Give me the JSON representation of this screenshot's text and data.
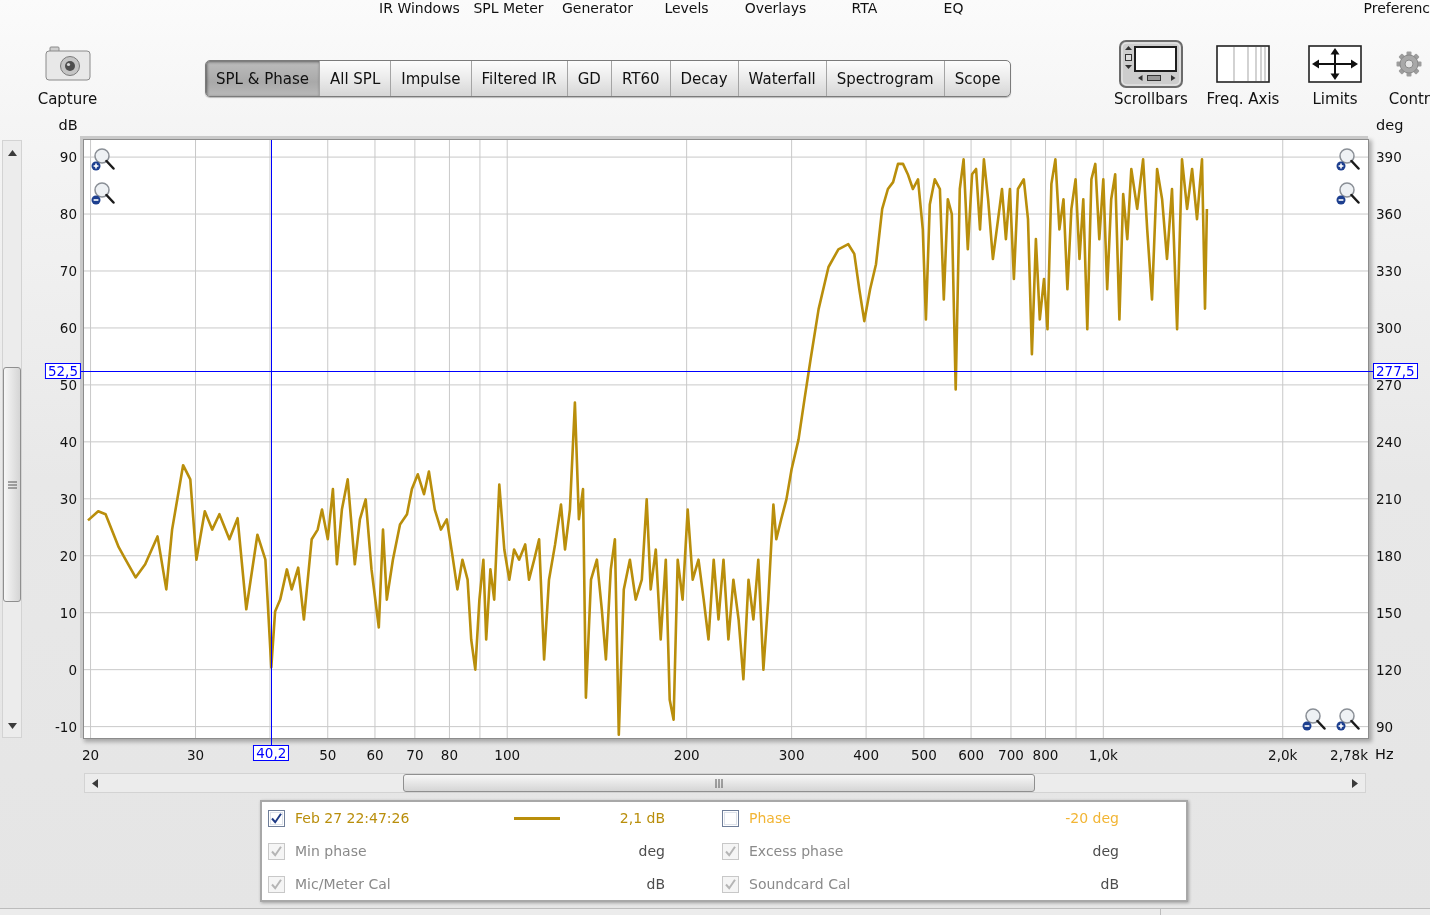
{
  "menu": [
    "IR Windows",
    "SPL Meter",
    "Generator",
    "Levels",
    "Overlays",
    "RTA",
    "EQ"
  ],
  "menu_right": [
    "Preferenc"
  ],
  "capture": {
    "label": "Capture"
  },
  "tabs": [
    {
      "label": "SPL & Phase",
      "selected": true
    },
    {
      "label": "All SPL",
      "selected": false
    },
    {
      "label": "Impulse",
      "selected": false
    },
    {
      "label": "Filtered IR",
      "selected": false
    },
    {
      "label": "GD",
      "selected": false
    },
    {
      "label": "RT60",
      "selected": false
    },
    {
      "label": "Decay",
      "selected": false
    },
    {
      "label": "Waterfall",
      "selected": false
    },
    {
      "label": "Spectrogram",
      "selected": false
    },
    {
      "label": "Scope",
      "selected": false
    }
  ],
  "tools": [
    {
      "label": "Scrollbars",
      "kind": "scrollbars",
      "on": true
    },
    {
      "label": "Freq. Axis",
      "kind": "grid",
      "on": false
    },
    {
      "label": "Limits",
      "kind": "arrows",
      "on": false
    },
    {
      "label": "Contr",
      "kind": "gear",
      "on": false
    }
  ],
  "graph": {
    "chart_data": {
      "type": "line",
      "log": "x",
      "grid": true,
      "xlabel": "Hz",
      "ylabel": "dB",
      "y2label": "deg",
      "xlim": [
        19.5,
        2780
      ],
      "ylim": [
        -12,
        93
      ],
      "y2lim": [
        84,
        399
      ],
      "xticks": [
        20,
        30,
        50,
        60,
        70,
        80,
        100,
        200,
        300,
        400,
        500,
        600,
        700,
        800,
        {
          "value": 1000,
          "label": "1,0k"
        },
        {
          "value": 2000,
          "label": "2,0k"
        },
        {
          "value": 2780,
          "label": "2,78k"
        }
      ],
      "yticks": [
        -10,
        0,
        10,
        20,
        30,
        40,
        50,
        60,
        70,
        80,
        90
      ],
      "y2ticks": [
        90,
        120,
        150,
        180,
        210,
        240,
        270,
        300,
        330,
        360,
        390
      ],
      "x": [
        19.8,
        20.6,
        21.2,
        22.3,
        22.9,
        23.8,
        24.7,
        25.9,
        26.8,
        27.4,
        28.6,
        29.4,
        30.1,
        31.1,
        32,
        32.9,
        34.2,
        35.3,
        36.5,
        38.1,
        39.3,
        40.2,
        40.8,
        41.6,
        42.7,
        43.5,
        44.6,
        45.6,
        47,
        48.1,
        48.9,
        50,
        51,
        51.8,
        52.8,
        54,
        55.5,
        56.6,
        57.9,
        59.2,
        60.9,
        61.9,
        62.8,
        64.3,
        66.1,
        67.9,
        69.2,
        70.8,
        72.5,
        73.9,
        75.6,
        77.4,
        79.2,
        80.9,
        82.5,
        84.1,
        85.8,
        87,
        88.4,
        89.8,
        91.2,
        92.2,
        93.7,
        95.1,
        97,
        98.9,
        100.8,
        102.7,
        104.7,
        107.2,
        108.8,
        111,
        113.1,
        115.3,
        117.5,
        120.3,
        123.1,
        125,
        127.4,
        129.9,
        131.9,
        134,
        135.5,
        138.2,
        141.4,
        144.1,
        146.4,
        149.2,
        151.6,
        153.9,
        156.9,
        160.6,
        164.3,
        168.2,
        171.4,
        174.1,
        177.5,
        180.9,
        184.5,
        187.3,
        190.2,
        193.2,
        196.9,
        200.8,
        204.7,
        209.4,
        213.6,
        217.6,
        222,
        226.2,
        230.6,
        235,
        239.6,
        244.4,
        249,
        254,
        258.8,
        263.8,
        269,
        274.2,
        279.6,
        282.8,
        288.2,
        294,
        300,
        308.1,
        315.3,
        322.8,
        333,
        345.9,
        359.4,
        373.5,
        382.2,
        389.7,
        397.2,
        406.2,
        415.6,
        425.6,
        435.2,
        444,
        452.4,
        461.2,
        470,
        479.2,
        488.8,
        498,
        503.9,
        511.6,
        521.5,
        532,
        540,
        548.5,
        557,
        565.5,
        574.5,
        583,
        592.5,
        602.3,
        611.7,
        621,
        630.6,
        640.8,
        652.8,
        666,
        676.2,
        686.4,
        697.2,
        708.1,
        718.9,
        735.7,
        747.6,
        758.8,
        770.7,
        782.6,
        795.2,
        806.2,
        818.4,
        831.2,
        844,
        857.6,
        870.4,
        884,
        898.4,
        912,
        925.6,
        940,
        955.2,
        969.6,
        984.8,
        1000,
        1015,
        1031,
        1047,
        1064,
        1080,
        1097,
        1114,
        1140,
        1166,
        1185,
        1207,
        1231,
        1255,
        1279,
        1304,
        1330,
        1355,
        1382,
        1409,
        1436,
        1464,
        1481,
        1492
      ],
      "series": [
        {
          "color": "#b98e0b",
          "values": [
            26.2,
            27.8,
            27.3,
            21.5,
            19.3,
            16.2,
            18.5,
            23.4,
            14.1,
            24.6,
            35.9,
            33.4,
            19.3,
            27.8,
            24.6,
            27.3,
            22.9,
            26.6,
            10.6,
            23.7,
            19.3,
            0.4,
            10.2,
            12.3,
            17.6,
            14.1,
            17.9,
            8.8,
            22.9,
            24.6,
            28.1,
            22.9,
            31.7,
            18.5,
            28.1,
            33.4,
            18.5,
            26.4,
            29.9,
            17.6,
            7.4,
            24.6,
            12.3,
            19.3,
            25.5,
            27.3,
            31.7,
            34.3,
            30.8,
            34.8,
            28.1,
            24.6,
            26.4,
            20.2,
            14.1,
            19.3,
            15.8,
            5.3,
            0,
            12.3,
            19.3,
            5.3,
            17.6,
            12.3,
            32.5,
            21.1,
            15.8,
            21.1,
            19.3,
            22,
            15.8,
            19.3,
            22.9,
            1.8,
            15.8,
            22,
            29,
            21.1,
            28.1,
            46.9,
            26.4,
            31.7,
            -4.9,
            15.8,
            19.3,
            10.6,
            1.8,
            17.6,
            22.9,
            -11.4,
            14.1,
            19.3,
            12.3,
            15.8,
            29.9,
            14.1,
            21.1,
            5.3,
            19.3,
            -5.3,
            -8.8,
            19.3,
            12.3,
            28.1,
            15.8,
            19.3,
            12.3,
            5.3,
            19.3,
            8.8,
            19.3,
            5.3,
            15.8,
            8.8,
            -1.7,
            15.8,
            8.8,
            19.3,
            0,
            12.3,
            29,
            22.9,
            26.4,
            29.9,
            35.2,
            40.4,
            47.5,
            54.5,
            63.3,
            70.7,
            73.8,
            74.7,
            73,
            66.8,
            61.2,
            66.8,
            71.2,
            80.9,
            84.4,
            85.6,
            88.8,
            88.8,
            87,
            84.4,
            86.1,
            77.3,
            61.5,
            81.7,
            86.1,
            84.4,
            65,
            82.6,
            80,
            49.2,
            84.4,
            89.6,
            73.8,
            87,
            87.9,
            77.3,
            89.6,
            82.6,
            72.1,
            79.1,
            84.4,
            75.6,
            84.4,
            68.6,
            84.4,
            86.1,
            79.1,
            55.4,
            75.6,
            61.5,
            68.6,
            59.8,
            85.3,
            89.6,
            77.3,
            82.6,
            66.8,
            80.9,
            86.1,
            72.1,
            82.6,
            59.8,
            86.1,
            88.8,
            75.6,
            86.1,
            66.8,
            82.6,
            87,
            61.5,
            83.5,
            75.6,
            87.9,
            80.9,
            89.6,
            77.3,
            65,
            87.9,
            82.6,
            72.1,
            84.4,
            59.8,
            89.6,
            80.9,
            87.9,
            79.1,
            89.6,
            63.4,
            80.9
          ]
        }
      ],
      "ref_lines": [
        {
          "axis": "x",
          "value": 40.2,
          "label": "40,2"
        },
        {
          "axis": "y",
          "value": 52.5,
          "label": "52,5"
        }
      ],
      "annotations": [
        "277,5"
      ]
    }
  },
  "legend": {
    "items": [
      {
        "label": "Feb 27 22:47:26",
        "value": "2,1 dB",
        "checked": true,
        "disabled": false,
        "color": "#b98e0b"
      },
      {
        "label": "Phase",
        "value": "-20 deg",
        "checked": false,
        "disabled": false,
        "color": "#f2b534"
      },
      {
        "label": "Min phase",
        "value": "deg",
        "checked": true,
        "disabled": true
      },
      {
        "label": "Excess phase",
        "value": "deg",
        "checked": true,
        "disabled": true
      },
      {
        "label": "Mic/Meter Cal",
        "value": "dB",
        "checked": true,
        "disabled": true
      },
      {
        "label": "Soundcard Cal",
        "value": "dB",
        "checked": true,
        "disabled": true
      }
    ]
  }
}
